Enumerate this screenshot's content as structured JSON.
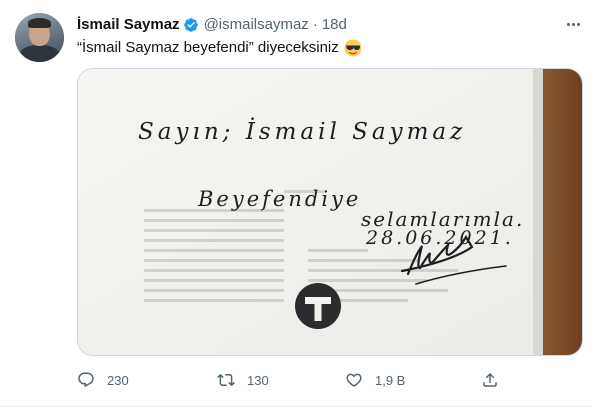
{
  "tweet": {
    "author_name": "İsmail Saymaz",
    "handle": "@ismailsaymaz",
    "separator": "·",
    "time": "18d",
    "text": "“İsmail Saymaz beyefendi” diyeceksiniz",
    "emoji": "smiling-face-with-sunglasses",
    "verified": true
  },
  "media": {
    "handwriting": {
      "line1": "Sayın; İsmail Saymaz",
      "line2": "Beyefendiye",
      "line3": "selamlarımla.",
      "line4": "28.06.2021."
    },
    "logo_letter": "T"
  },
  "actions": {
    "reply_count": "230",
    "retweet_count": "130",
    "like_count": "1,9 B"
  },
  "colors": {
    "verified_blue": "#1d9bf0",
    "text_secondary": "#536471"
  }
}
